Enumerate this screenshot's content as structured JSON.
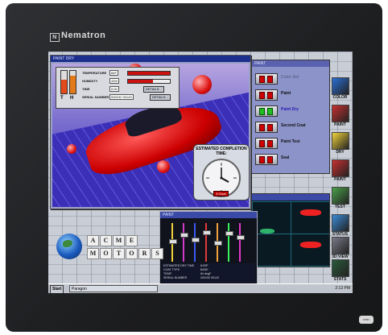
{
  "device": {
    "brand": "Nematron",
    "badge": "intel"
  },
  "gauges_panel": {
    "title": "PAINT DRY",
    "th": {
      "t": "T",
      "h": "H",
      "t_level": 0.62,
      "h_level": 0.78
    },
    "rows": [
      {
        "label": "TEMPERATURE",
        "value": "84F"
      },
      {
        "label": "HUMIDITY",
        "value": "43%"
      },
      {
        "label": "TIME",
        "value": "0:00",
        "button": "DETAILS..."
      },
      {
        "label": "SERIAL NUMBER",
        "value": "000192 00143",
        "button": "DETAILS..."
      }
    ]
  },
  "paint_window": {
    "title": "PAINT",
    "steps": [
      {
        "label": "Color Set",
        "state": "dim"
      },
      {
        "label": "Paint",
        "state": "normal"
      },
      {
        "label": "Paint Dry",
        "state": "active"
      },
      {
        "label": "Second Coat",
        "state": "normal"
      },
      {
        "label": "Paint Test",
        "state": "normal"
      },
      {
        "label": "Seal",
        "state": "normal"
      }
    ]
  },
  "clock_panel": {
    "title": "ESTIMATED COMPLETION TIME:",
    "time": "3:00pm"
  },
  "mixer": {
    "title": "PAINT",
    "info": [
      {
        "k": "ESTIMATED DRY TIME",
        "v": "8:00P"
      },
      {
        "k": "COAT TYPE",
        "v": "BASE"
      },
      {
        "k": "TEMP",
        "v": "84 degF"
      },
      {
        "k": "SERIAL NUMBER",
        "v": "000192 00143"
      }
    ],
    "slider_colors": [
      "#f2d23a",
      "#d23ac8",
      "#3a5af2",
      "#e23a3a",
      "#f2a03a",
      "#3af25a",
      "#e23ac8"
    ],
    "slider_levels": [
      0.55,
      0.72,
      0.6,
      0.8,
      0.5,
      0.78,
      0.66
    ]
  },
  "acme": {
    "row1": [
      "A",
      "C",
      "M",
      "E"
    ],
    "row2": [
      "M",
      "O",
      "T",
      "O",
      "R",
      "S"
    ]
  },
  "toolbar": [
    {
      "label": "COLOR",
      "color": "#2a6fd6"
    },
    {
      "label": "PAINT",
      "color": "#c83030"
    },
    {
      "label": "DRY",
      "color": "#f0d23a"
    },
    {
      "label": "PAINT",
      "color": "#c83030"
    },
    {
      "label": "TEST",
      "color": "#4aa04a"
    },
    {
      "label": "STATUS",
      "color": "#3a8ad6"
    },
    {
      "label": "3D VIEW",
      "color": "#7a7a8a"
    },
    {
      "label": "STATS",
      "color": "#2a5a3a"
    }
  ],
  "taskbar": {
    "start": "Start",
    "task": "Paragon",
    "time": "2:13 PM"
  }
}
